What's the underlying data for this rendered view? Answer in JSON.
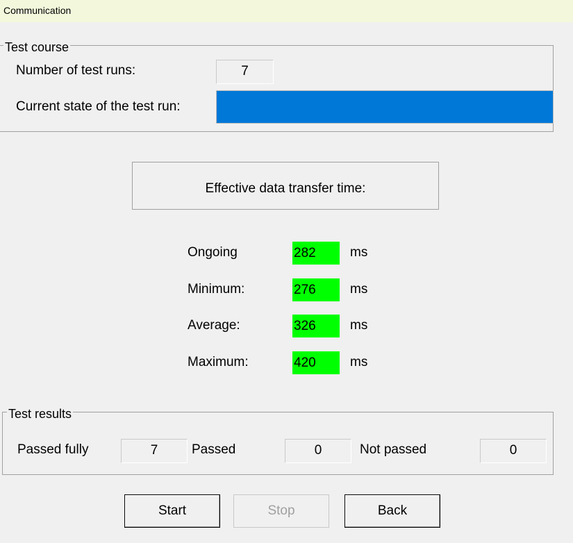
{
  "window": {
    "title": "Communication"
  },
  "test_course": {
    "legend": "Test course",
    "runs_label": "Number of test runs:",
    "runs_value": "7",
    "state_label": "Current state of the test run:",
    "progress_fraction": 1.0,
    "progress_color": "#0078d7"
  },
  "transfer": {
    "heading": "Effective data transfer time:",
    "highlight_color": "#00ff00",
    "rows": [
      {
        "label": "Ongoing",
        "value": "282",
        "unit": "ms"
      },
      {
        "label": "Minimum:",
        "value": "276",
        "unit": "ms"
      },
      {
        "label": "Average:",
        "value": "326",
        "unit": "ms"
      },
      {
        "label": "Maximum:",
        "value": "420",
        "unit": "ms"
      }
    ]
  },
  "test_results": {
    "legend": "Test results",
    "passed_fully_label": "Passed fully",
    "passed_fully_value": "7",
    "passed_label": "Passed",
    "passed_value": "0",
    "not_passed_label": "Not passed",
    "not_passed_value": "0"
  },
  "buttons": {
    "start": "Start",
    "stop": "Stop",
    "back": "Back"
  }
}
